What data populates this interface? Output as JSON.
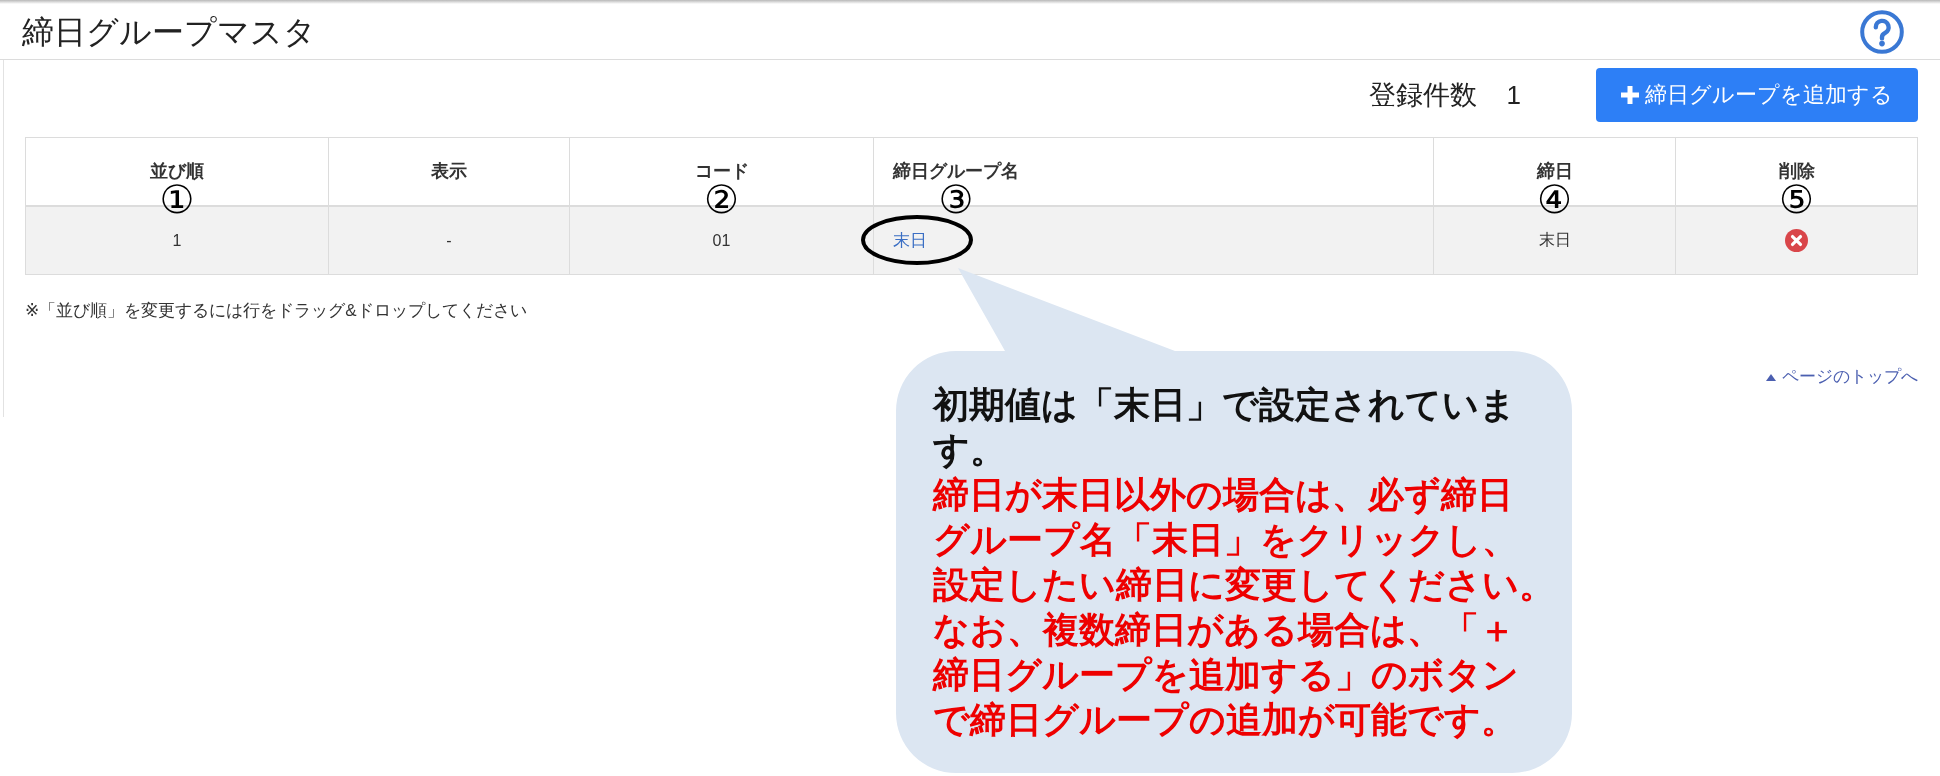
{
  "page": {
    "title": "締日グループマスタ"
  },
  "toolbar": {
    "count_label": "登録件数",
    "count": "1",
    "add_button": "締日グループを追加する"
  },
  "table": {
    "columns": [
      {
        "label": "並び順",
        "marker": "①"
      },
      {
        "label": "表示"
      },
      {
        "label": "コード",
        "marker": "②"
      },
      {
        "label": "締日グループ名",
        "marker": "③"
      },
      {
        "label": "締日",
        "marker": "④"
      },
      {
        "label": "削除",
        "marker": "⑤"
      }
    ],
    "rows": [
      {
        "cells": [
          {
            "kind": "text",
            "text": "1",
            "circled": false
          },
          {
            "kind": "text",
            "text": "-",
            "circled": false
          },
          {
            "kind": "text",
            "text": "01",
            "circled": false
          },
          {
            "kind": "link",
            "text": "末日",
            "circled": true
          },
          {
            "kind": "text",
            "text": "末日",
            "circled": false
          },
          {
            "kind": "delete",
            "circled": false
          }
        ]
      }
    ]
  },
  "note": "※「並び順」を変更するには行をドラッグ&ドロップしてください",
  "page_top_link": "ページのトップへ",
  "callout": {
    "paragraphs": [
      {
        "kind": "info",
        "lines": [
          "初期値は「末日」で設定されていま",
          "す。"
        ]
      },
      {
        "kind": "warning",
        "lines": [
          "締日が末日以外の場合は、必ず締日",
          "グループ名「末日」をクリックし、",
          "設定したい締日に変更してください。",
          "なお、複数締日がある場合は、「＋",
          "締日グループを追加する」のボタン",
          "で締日グループの追加が可能です。"
        ]
      }
    ]
  }
}
